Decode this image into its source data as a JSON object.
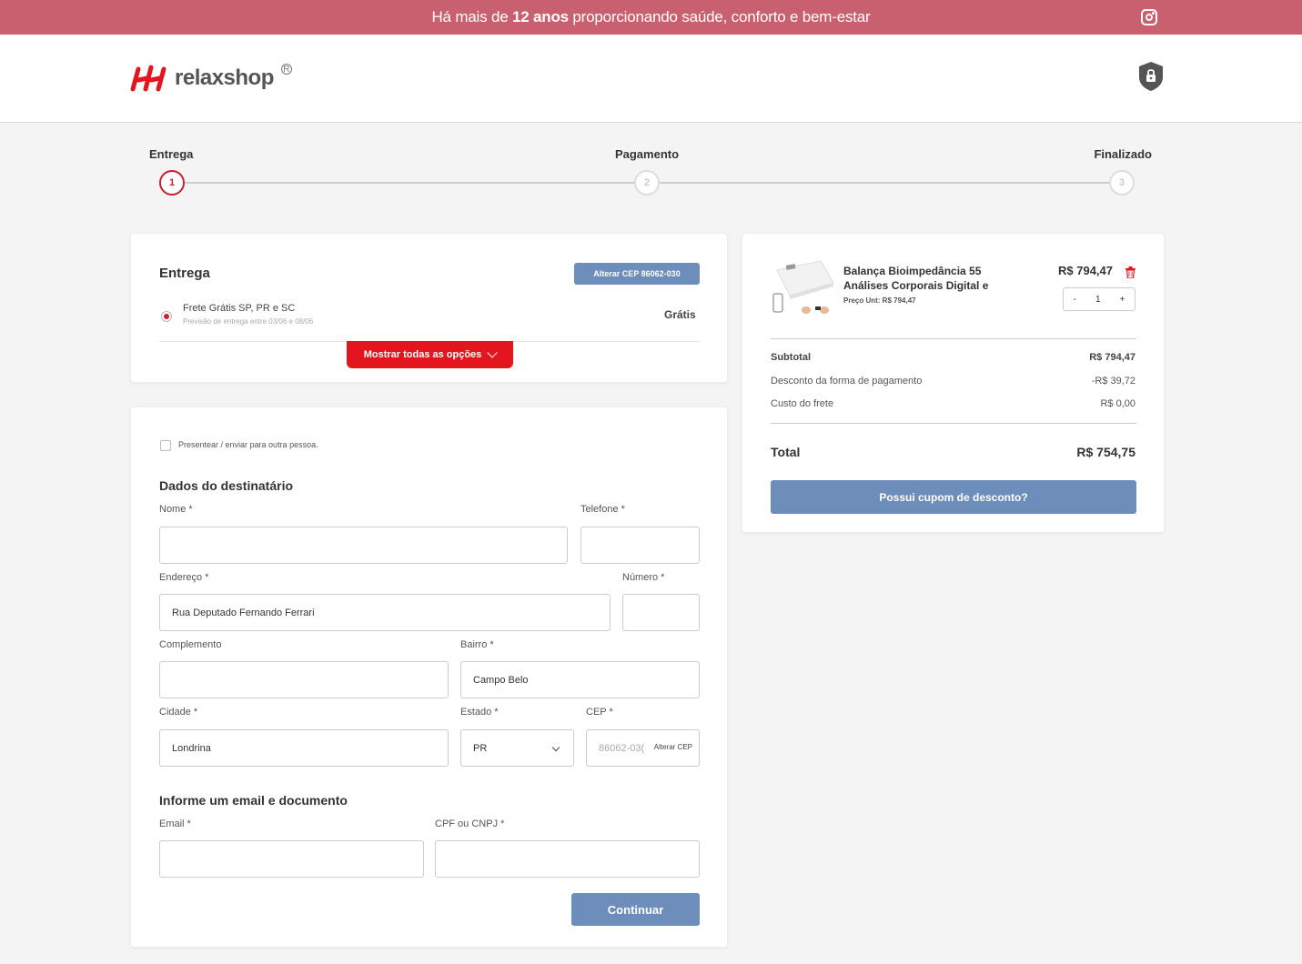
{
  "topbar": {
    "message_prefix": "Há mais de ",
    "message_bold": "12 anos",
    "message_suffix": " proporcionando saúde, conforto e bem-estar",
    "social_icon": "instagram-icon"
  },
  "header": {
    "logo_text": "relaxshop",
    "logo_reg": "R",
    "security_icon": "shield-lock-icon"
  },
  "steps": [
    {
      "label": "Entrega",
      "number": "1",
      "active": true
    },
    {
      "label": "Pagamento",
      "number": "2",
      "active": false
    },
    {
      "label": "Finalizado",
      "number": "3",
      "active": false
    }
  ],
  "delivery": {
    "title": "Entrega",
    "change_cep_label": "Alterar CEP 86062-030",
    "option_name": "Frete Grátis SP, PR e SC",
    "option_eta": "Previsão de entrega entre 03/06 e 08/06",
    "option_price": "Grátis",
    "show_all_label": "Mostrar todas as opções"
  },
  "form": {
    "gift_label": "Presentear / enviar para outra pessoa.",
    "recipient_title": "Dados do destinatário",
    "nome_label": "Nome *",
    "nome_value": "",
    "telefone_label": "Telefone *",
    "telefone_value": "",
    "endereco_label": "Endereço *",
    "endereco_value": "Rua Deputado Fernando Ferrari",
    "numero_label": "Número *",
    "numero_value": "",
    "complemento_label": "Complemento",
    "complemento_value": "",
    "bairro_label": "Bairro *",
    "bairro_value": "Campo Belo",
    "cidade_label": "Cidade *",
    "cidade_value": "Londrina",
    "estado_label": "Estado *",
    "estado_value": "PR",
    "cep_label": "CEP *",
    "cep_value": "86062-03(",
    "cep_change_label": "Alterar CEP",
    "contact_title": "Informe um email e documento",
    "email_label": "Email *",
    "email_value": "",
    "cpf_label": "CPF ou CNPJ *",
    "cpf_value": "",
    "continue_label": "Continuar"
  },
  "cart": {
    "product_name_line1": "Balança Bioimpedância 55",
    "product_name_line2": "Análises Corporais Digital e",
    "unit_price_label": "Preço Unt: R$ 794,47",
    "price": "R$ 794,47",
    "quantity": "1",
    "qty_minus": "-",
    "qty_plus": "+",
    "subtotal_label": "Subtotal",
    "subtotal_value": "R$ 794,47",
    "discount_label": "Desconto da forma de pagamento",
    "discount_value": "-R$ 39,72",
    "shipping_label": "Custo do frete",
    "shipping_value": "R$ 0,00",
    "total_label": "Total",
    "total_value": "R$ 754,75",
    "coupon_label": "Possui cupom de desconto?"
  },
  "colors": {
    "topbar": "#c8606f",
    "accent_red": "#e3151f",
    "button_blue": "#6d8eba"
  }
}
